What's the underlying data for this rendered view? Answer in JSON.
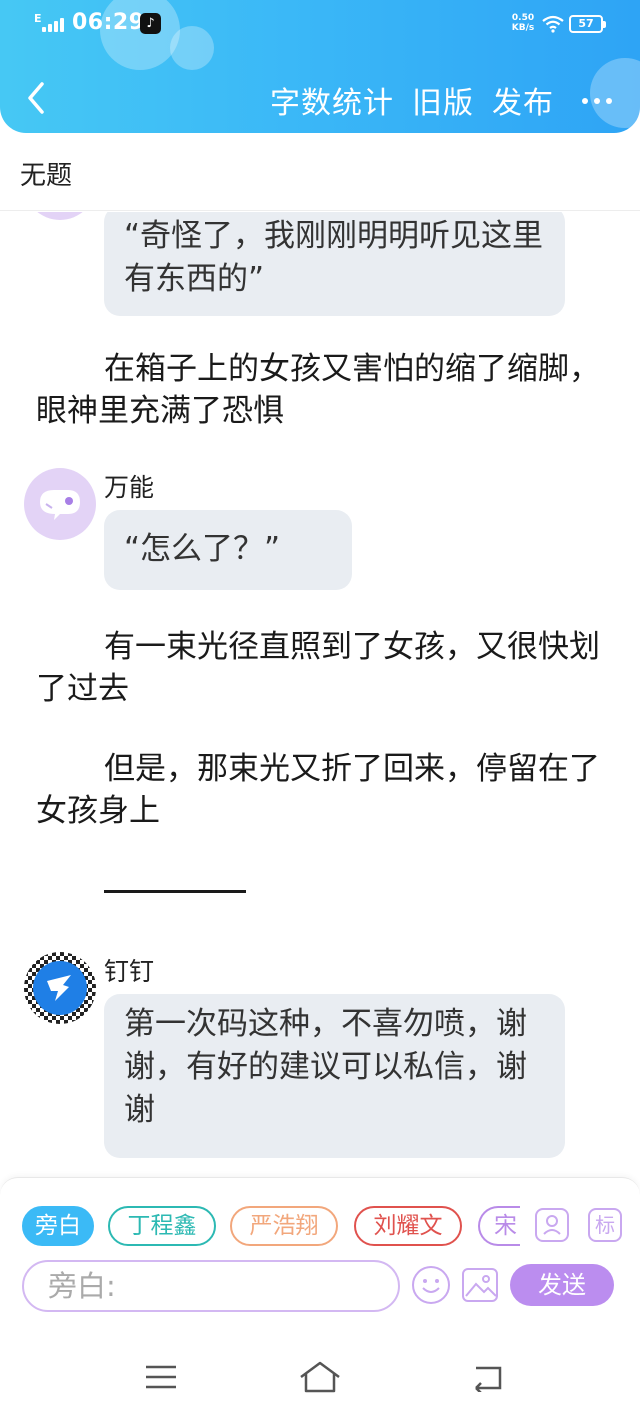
{
  "status_bar": {
    "network": "E",
    "time": "06:29",
    "speed_value": "0.50",
    "speed_unit": "KB/s",
    "battery": "57"
  },
  "header": {
    "word_count_label": "字数统计",
    "old_version_label": "旧版",
    "publish_label": "发布"
  },
  "document": {
    "title": "无题"
  },
  "content": {
    "bubble1": "“奇怪了，我刚刚明明听见这里有东西的”",
    "para1": "在箱子上的女孩又害怕的缩了缩脚，眼神里充满了恐惧",
    "speaker2": "万能",
    "bubble2": "“怎么了？”",
    "para2": "有一束光径直照到了女孩，又很快划了过去",
    "para3": "但是，那束光又折了回来，停留在了女孩身上",
    "speaker3": "钉钉",
    "bubble3": "第一次码这种，不喜勿喷，谢谢，有好的建议可以私信，谢谢"
  },
  "input_area": {
    "chips": [
      {
        "label": "旁白",
        "color": "#3bbaf6"
      },
      {
        "label": "丁程鑫",
        "color": "#2cb9b3"
      },
      {
        "label": "严浩翔",
        "color": "#f2a77c"
      },
      {
        "label": "刘耀文",
        "color": "#e0524e"
      },
      {
        "label": "宋",
        "color": "#b98be8"
      }
    ],
    "tag_icon_label": "标",
    "input_value": "旁白:",
    "send_label": "发送"
  },
  "colors": {
    "header_gradient_start": "#46c8f4",
    "header_gradient_end": "#2ea4f5",
    "bubble_bg": "#e9edf2",
    "accent_purple": "#bb8def"
  }
}
